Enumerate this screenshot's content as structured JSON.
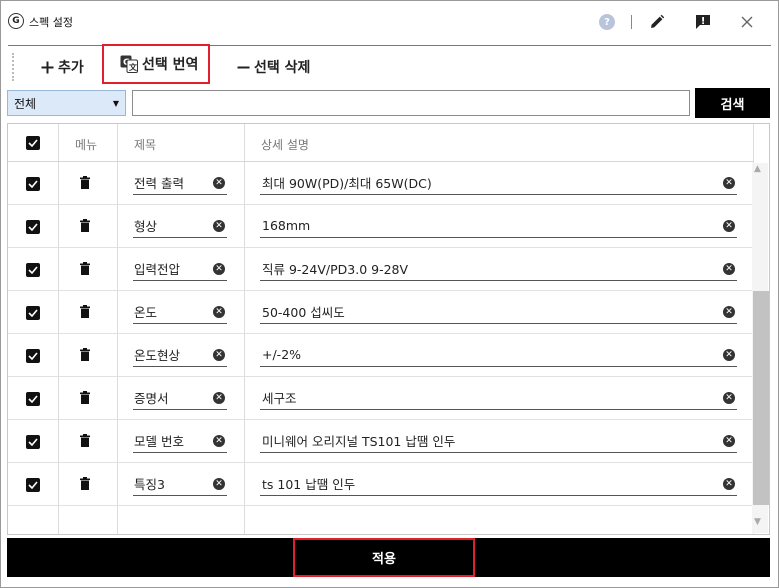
{
  "window": {
    "title": "스펙 설정",
    "app_icon_glyph": "G",
    "help_glyph": "?"
  },
  "toolbar": {
    "add_label": "추가",
    "translate_label": "선택 번역",
    "delete_label": "선택 삭제"
  },
  "search": {
    "filter_value": "전체",
    "value": "",
    "button_label": "검색"
  },
  "grid": {
    "headers": {
      "menu": "메뉴",
      "title": "제목",
      "description": "상세 설명"
    },
    "rows": [
      {
        "title": "전력 출력",
        "description": "최대 90W(PD)/최대 65W(DC)"
      },
      {
        "title": "형상",
        "description": "168mm"
      },
      {
        "title": "입력전압",
        "description": "직류 9-24V/PD3.0 9-28V"
      },
      {
        "title": "온도",
        "description": "50-400 섭씨도"
      },
      {
        "title": "온도현상",
        "description": "+/-2%"
      },
      {
        "title": "증명서",
        "description": "세구조"
      },
      {
        "title": "모델 번호",
        "description": "미니웨어 오리지널 TS101 납땜 인두"
      },
      {
        "title": "특징3",
        "description": "ts 101 납땜 인두"
      }
    ]
  },
  "footer": {
    "apply_label": "적용"
  },
  "colors": {
    "highlight": "#e0202a",
    "accent": "#000000",
    "select_bg": "#dbe9f8"
  },
  "icons": [
    "plus-icon",
    "translate-icon",
    "minus-icon",
    "edit-icon",
    "alert-icon",
    "close-icon",
    "trash-icon",
    "clear-icon",
    "chevron-down-icon"
  ]
}
